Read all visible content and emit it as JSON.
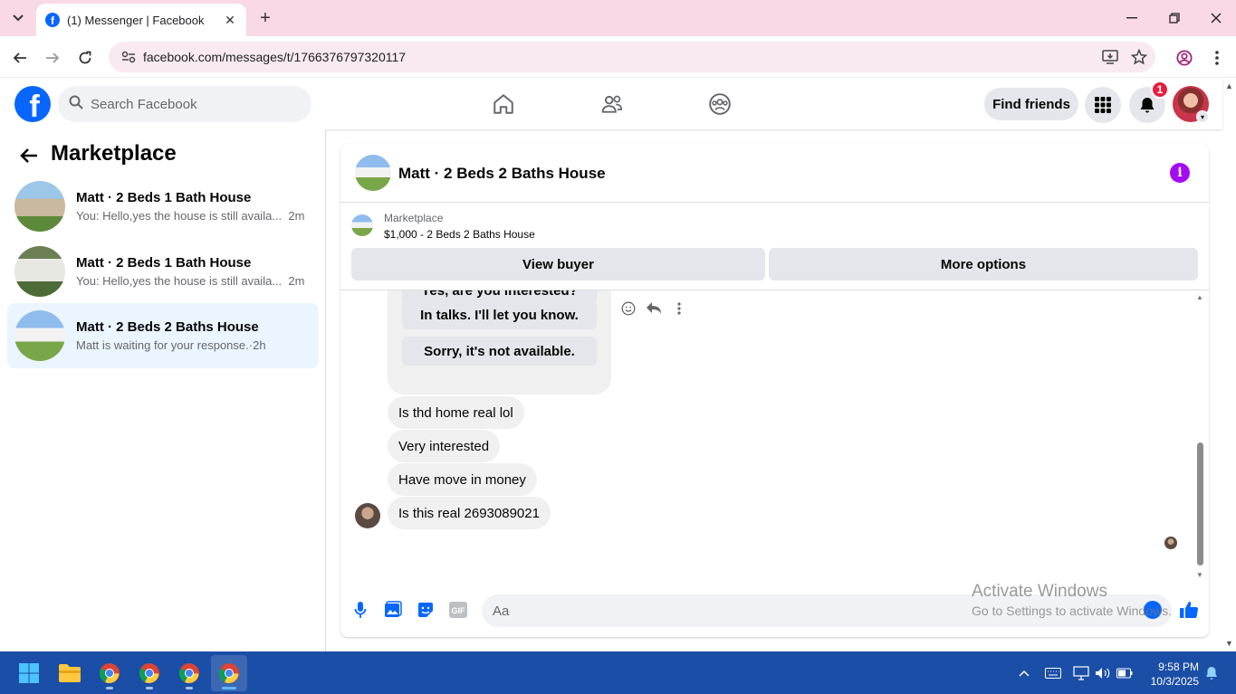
{
  "browser": {
    "tab_title": "(1) Messenger | Facebook",
    "url": "facebook.com/messages/t/1766376797320117"
  },
  "fb_nav": {
    "search_placeholder": "Search Facebook",
    "find_friends_label": "Find friends",
    "notification_count": "1"
  },
  "sidebar": {
    "title": "Marketplace",
    "conversations": [
      {
        "name": "Matt · 2 Beds 1 Bath House",
        "snippet": "You: Hello,yes the house is still availa...",
        "time": "2m"
      },
      {
        "name": "Matt · 2 Beds 1 Bath House",
        "snippet": "You: Hello,yes the house is still availa...",
        "time": "2m"
      },
      {
        "name": "Matt · 2 Beds 2 Baths House",
        "snippet": "Matt is waiting for your response.",
        "time": "2h"
      }
    ]
  },
  "chat": {
    "title": "Matt · 2 Beds 2 Baths House",
    "marketplace_label": "Marketplace",
    "listing": "$1,000 - 2 Beds 2 Baths House",
    "view_buyer_label": "View buyer",
    "more_options_label": "More options",
    "quick_replies": [
      "Yes, are you interested?",
      "In talks. I'll let you know.",
      "Sorry, it's not available."
    ],
    "messages": [
      "Is thd home real lol",
      "Very interested",
      "Have move in money",
      "Is this real 2693089021"
    ],
    "composer_placeholder": "Aa"
  },
  "watermark": {
    "line1": "Activate Windows",
    "line2": "Go to Settings to activate Windows."
  },
  "taskbar": {
    "time": "9:58 PM",
    "date": "10/3/2025"
  },
  "colors": {
    "fb_blue": "#0866ff",
    "tab_strip": "#f9d9e6",
    "active_conversation": "#ebf5ff",
    "info_purple": "#a30cf3",
    "notification_red": "#e41e3f",
    "taskbar": "#1b4ea6"
  }
}
